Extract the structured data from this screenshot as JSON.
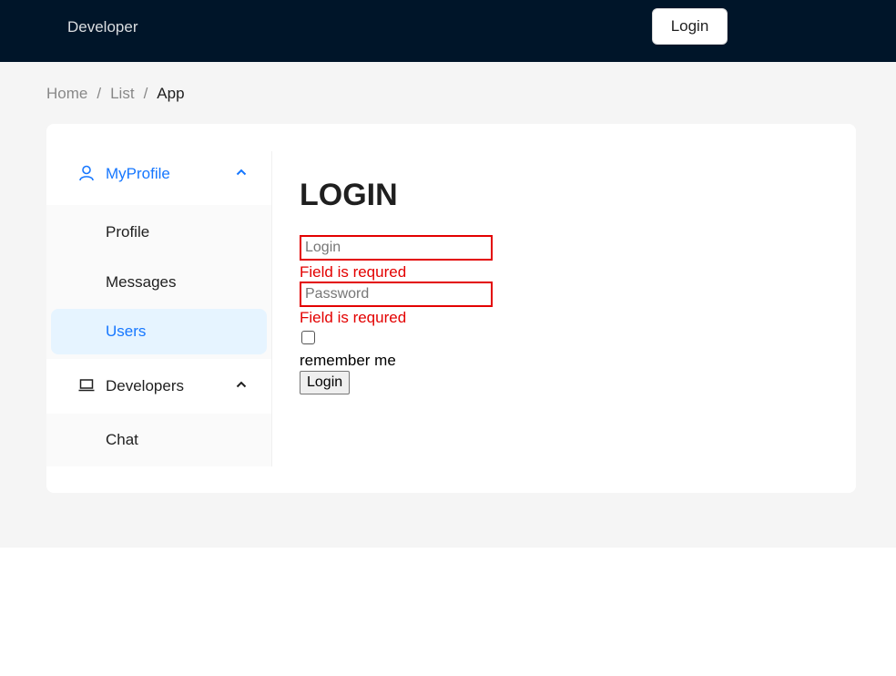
{
  "header": {
    "brand": "Developer",
    "login_button": "Login",
    "background_color": "#001529"
  },
  "breadcrumb": {
    "items": [
      "Home",
      "List",
      "App"
    ],
    "separator": "/"
  },
  "sidebar": {
    "groups": [
      {
        "label": "MyProfile",
        "icon": "user-icon",
        "expanded": true,
        "active": true,
        "items": [
          {
            "label": "Profile",
            "selected": false
          },
          {
            "label": "Messages",
            "selected": false
          },
          {
            "label": "Users",
            "selected": true
          }
        ]
      },
      {
        "label": "Developers",
        "icon": "laptop-icon",
        "expanded": true,
        "active": false,
        "items": [
          {
            "label": "Chat",
            "selected": false
          }
        ]
      }
    ],
    "accent_color": "#1677ff",
    "selected_bg": "#e6f4ff"
  },
  "login_form": {
    "title": "LOGIN",
    "login_placeholder": "Login",
    "login_value": "",
    "login_error": "Field is requred",
    "password_placeholder": "Password",
    "password_value": "",
    "password_error": "Field is requred",
    "remember_label": "remember me",
    "remember_checked": false,
    "submit_label": "Login",
    "error_color": "#e30000"
  }
}
